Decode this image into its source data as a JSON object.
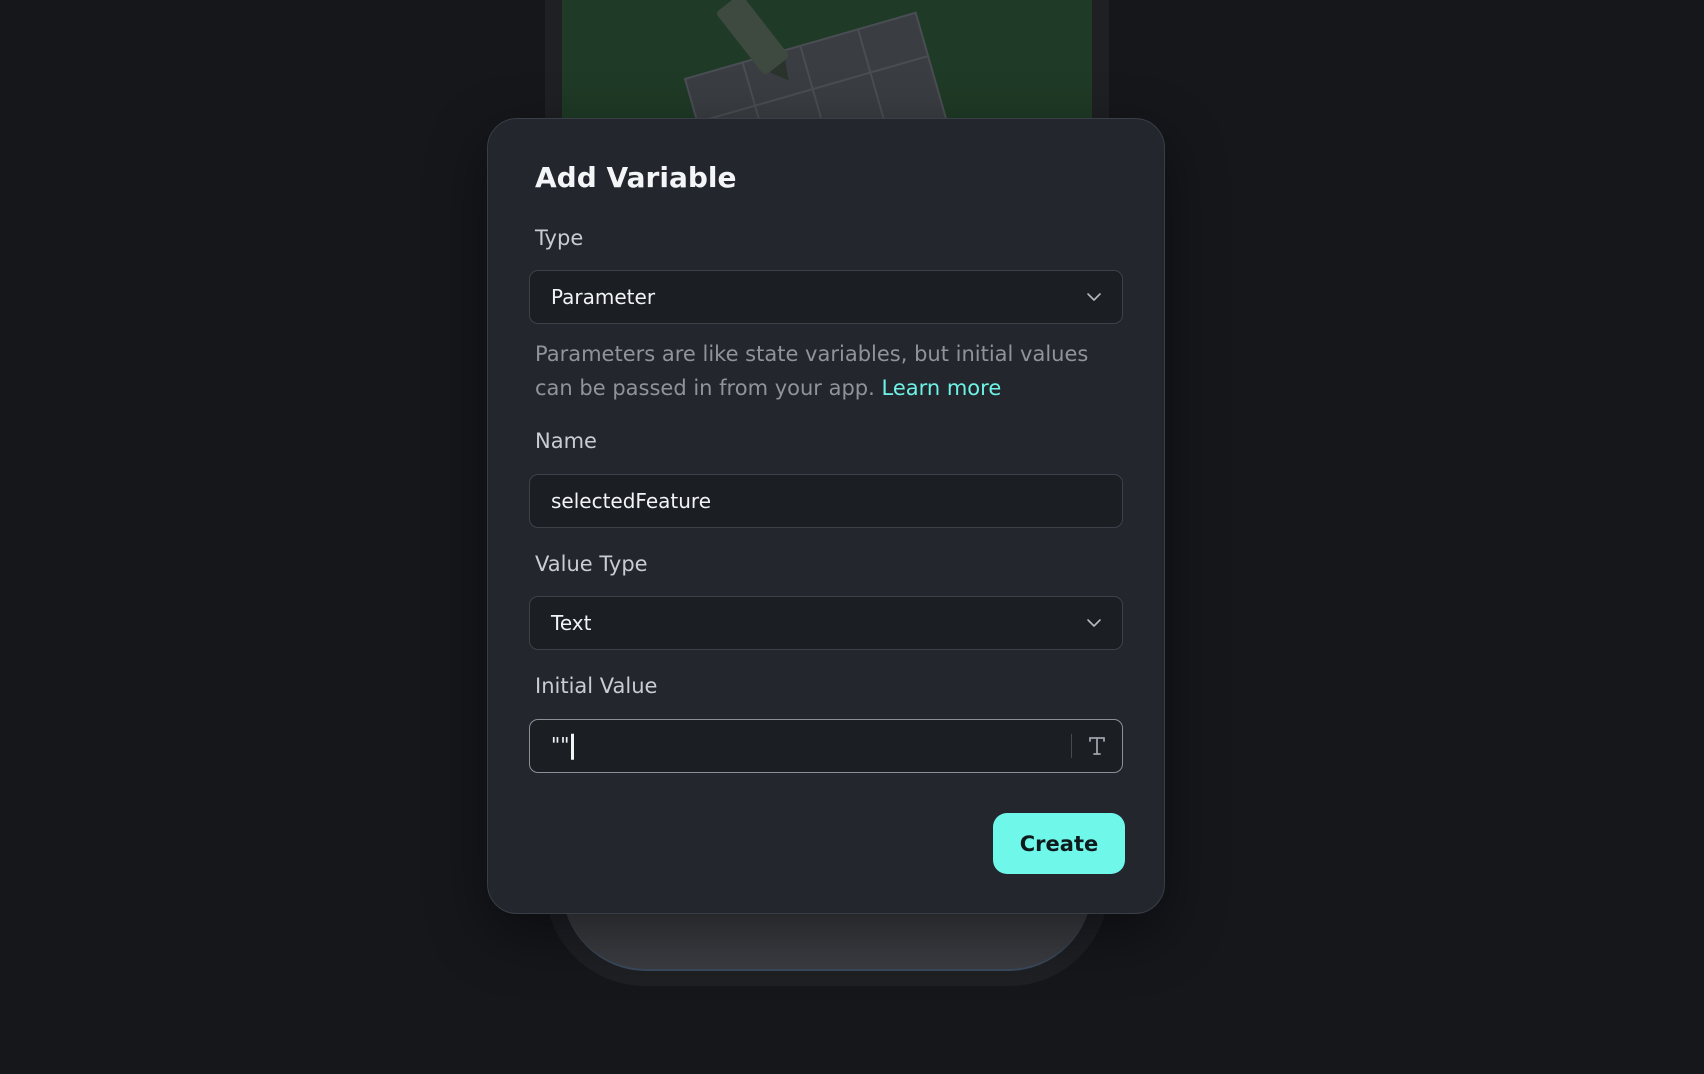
{
  "dialog": {
    "title": "Add Variable",
    "type_field": {
      "label": "Type",
      "selected": "Parameter",
      "icon": "chevron-down-icon"
    },
    "helper": {
      "text": "Parameters are like state variables, but initial values can be passed in from your app. ",
      "link_label": "Learn more"
    },
    "name_field": {
      "label": "Name",
      "value": "selectedFeature"
    },
    "value_type_field": {
      "label": "Value Type",
      "selected": "Text",
      "icon": "chevron-down-icon"
    },
    "initial_value_field": {
      "label": "Initial Value",
      "value": "\"\"",
      "icon": "text-type-icon"
    },
    "create_label": "Create"
  },
  "colors": {
    "background": "#15171b",
    "dialog": "#23262d",
    "accent": "#6ff7ea",
    "link": "#6ff2e6"
  }
}
